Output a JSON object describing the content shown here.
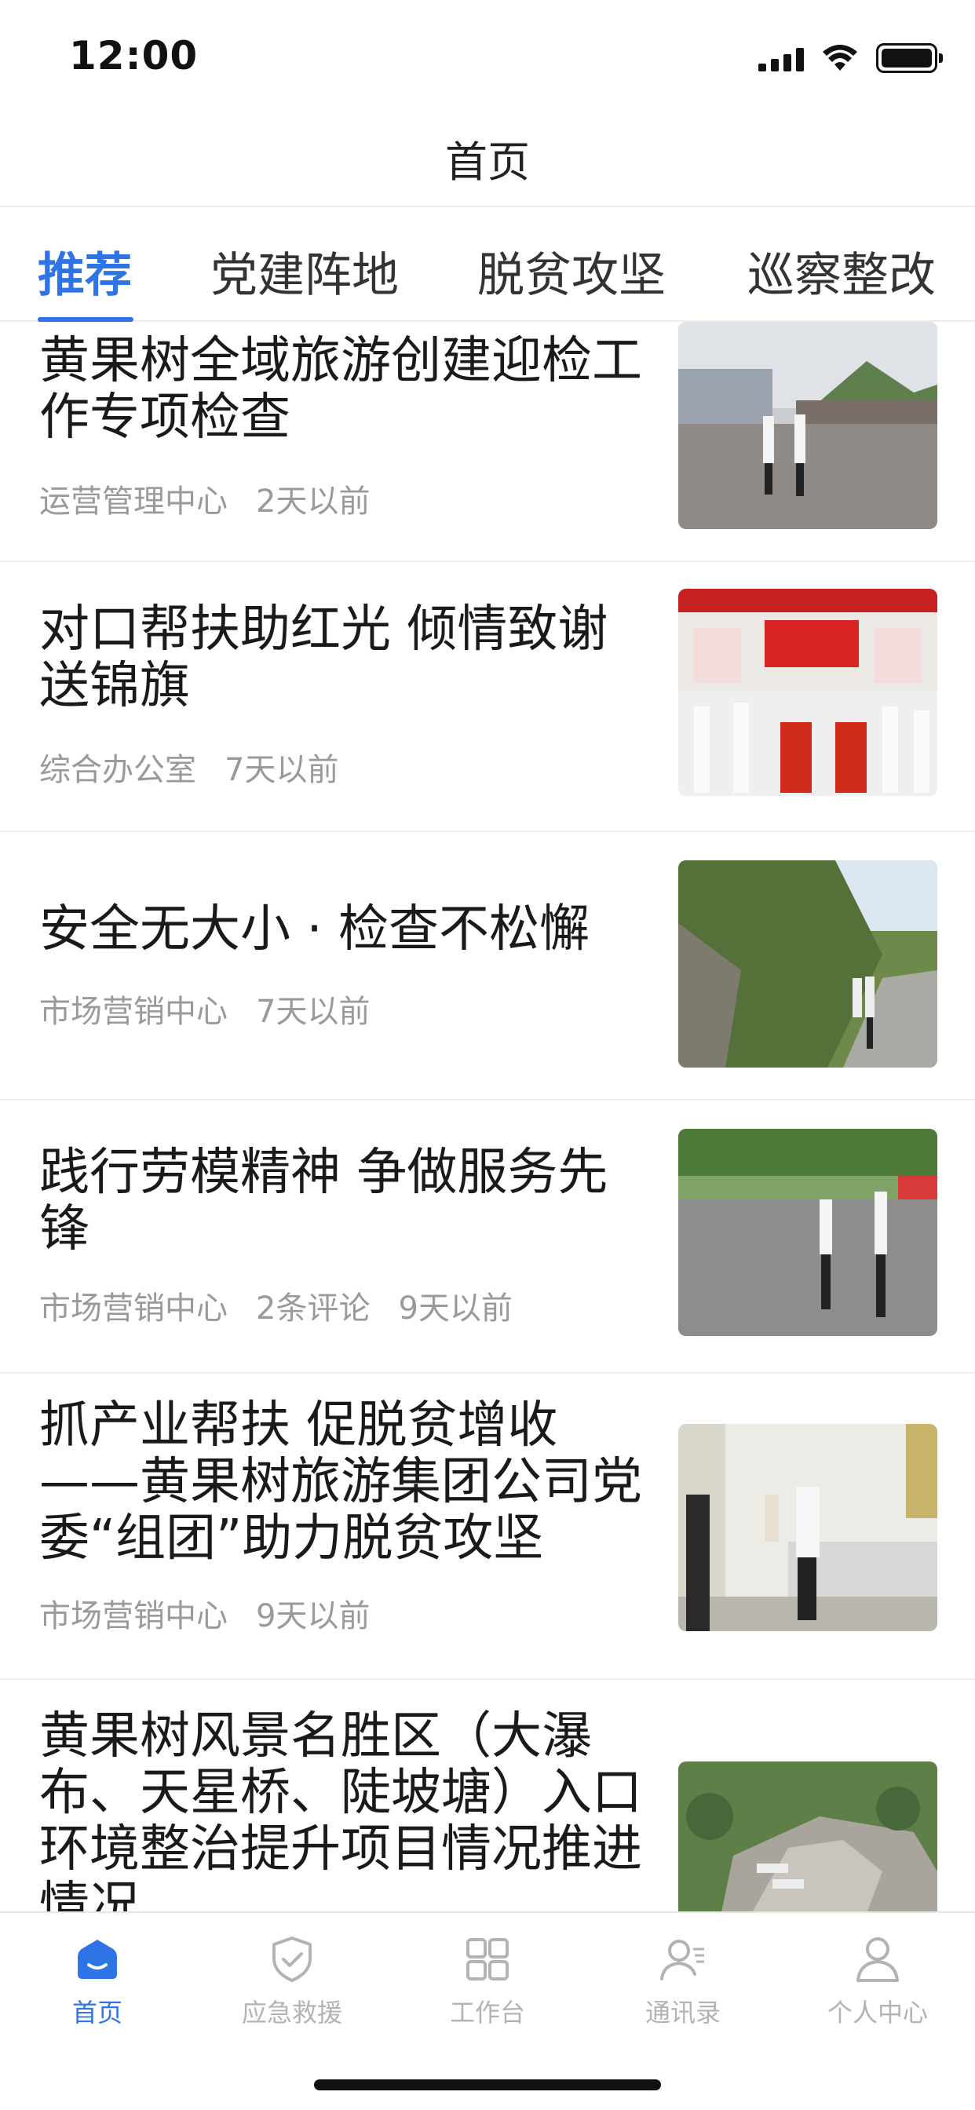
{
  "status_bar": {
    "time": "12:00"
  },
  "nav": {
    "title": "首页"
  },
  "tabs": [
    {
      "label": "推荐",
      "active": true
    },
    {
      "label": "党建阵地",
      "active": false
    },
    {
      "label": "脱贫攻坚",
      "active": false
    },
    {
      "label": "巡察整改",
      "active": false
    }
  ],
  "articles": [
    {
      "title": " 黄果树全域旅游创建迎检工作专项检查",
      "source": "运营管理中心",
      "comments": "",
      "time": "2天以前"
    },
    {
      "title": "对口帮扶助红光  倾情致谢送锦旗",
      "source": "综合办公室",
      "comments": "",
      "time": "7天以前"
    },
    {
      "title": "安全无大小 · 检查不松懈",
      "source": "市场营销中心",
      "comments": "",
      "time": "7天以前"
    },
    {
      "title": " 践行劳模精神   争做服务先锋",
      "source": "市场营销中心",
      "comments": "2条评论",
      "time": "9天以前"
    },
    {
      "title": " 抓产业帮扶   促脱贫增收——黄果树旅游集团公司党委“组团”助力脱贫攻坚",
      "source": "市场营销中心",
      "comments": "",
      "time": "9天以前"
    },
    {
      "title": "黄果树风景名胜区（大瀑布、天星桥、陡坡塘）入口环境整治提升项目情况推进情况",
      "source": "",
      "comments": "",
      "time": ""
    }
  ],
  "tab_bar": {
    "items": [
      {
        "label": "首页",
        "icon": "home-icon",
        "active": true
      },
      {
        "label": "应急救援",
        "icon": "shield-check-icon",
        "active": false
      },
      {
        "label": "工作台",
        "icon": "grid-icon",
        "active": false
      },
      {
        "label": "通讯录",
        "icon": "contacts-icon",
        "active": false
      },
      {
        "label": "个人中心",
        "icon": "user-icon",
        "active": false
      }
    ]
  },
  "colors": {
    "accent": "#2f74e6",
    "text": "#1a1a1a",
    "meta": "#9a9a9a",
    "inactive_icon": "#b3b3b3"
  }
}
